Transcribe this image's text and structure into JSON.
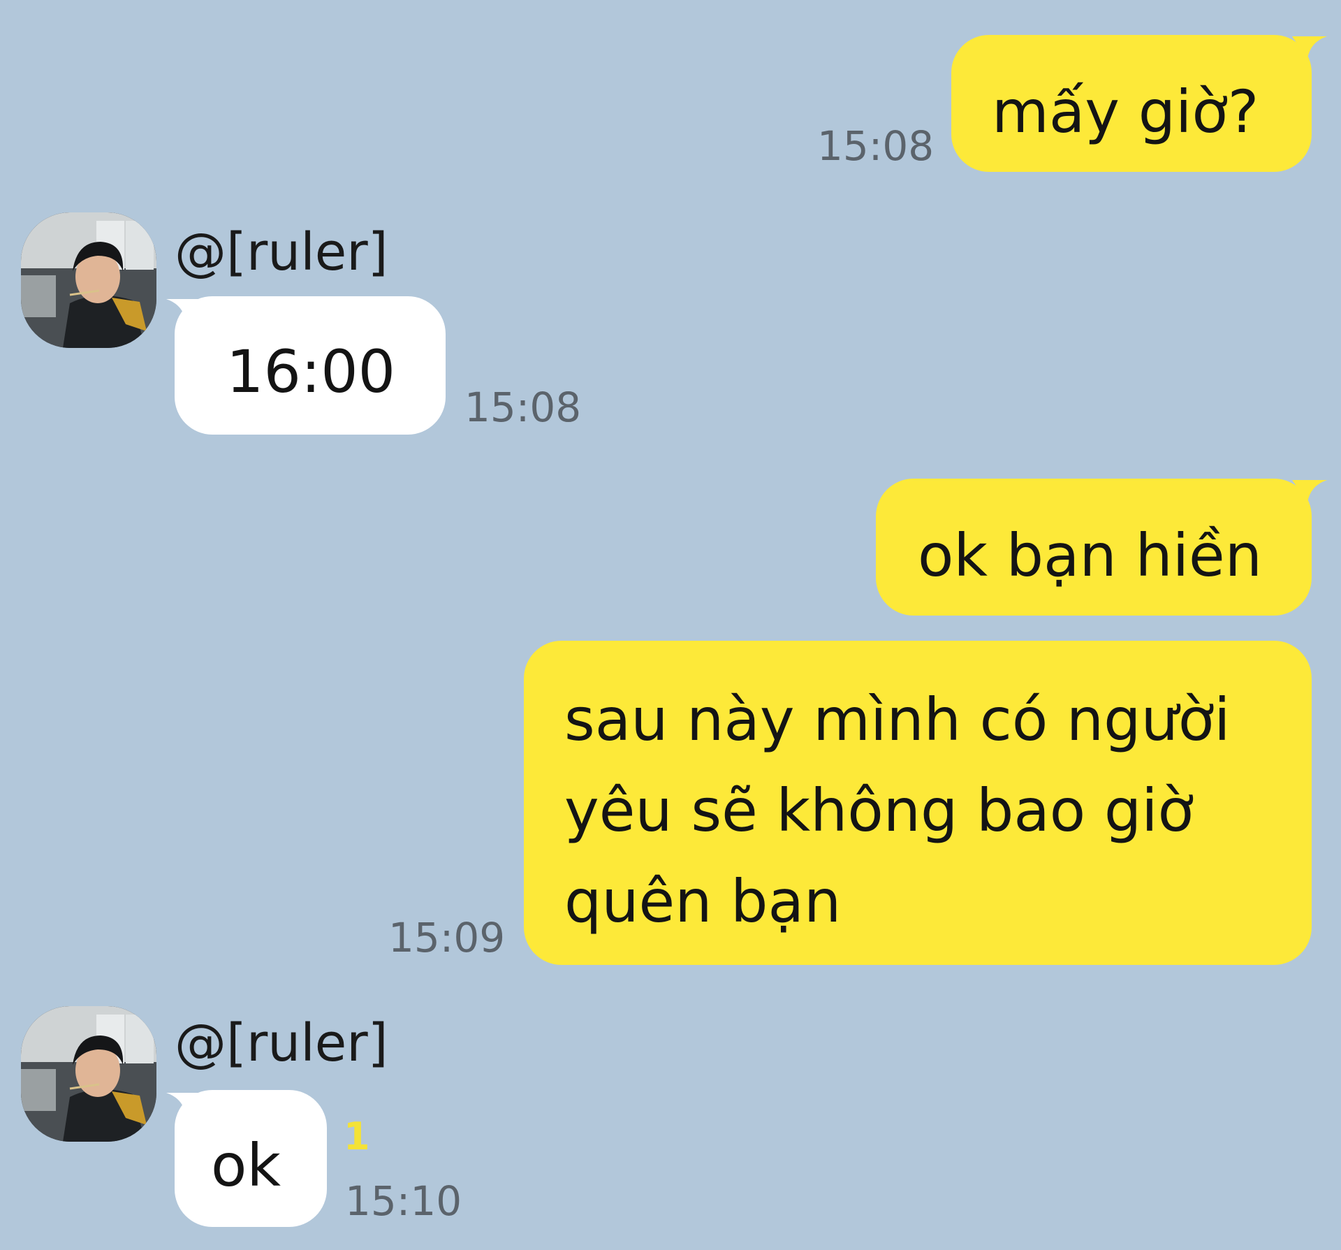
{
  "colors": {
    "background": "#b2c7da",
    "sent_bubble": "#fde939",
    "received_bubble": "#ffffff",
    "timestamp": "#5b636b",
    "unread_count": "#f4e237"
  },
  "contact": {
    "name": "@[ruler]"
  },
  "messages": [
    {
      "direction": "sent",
      "text": "mấy giờ?",
      "time": "15:08"
    },
    {
      "direction": "received",
      "sender": "@[ruler]",
      "text": "16:00",
      "time": "15:08"
    },
    {
      "direction": "sent",
      "text": "ok bạn hiền"
    },
    {
      "direction": "sent",
      "lines": [
        "sau này mình có người",
        "yêu sẽ không bao giờ",
        "quên bạn"
      ],
      "time": "15:09"
    },
    {
      "direction": "received",
      "sender": "@[ruler]",
      "text": "ok",
      "unread": "1",
      "time": "15:10"
    }
  ]
}
